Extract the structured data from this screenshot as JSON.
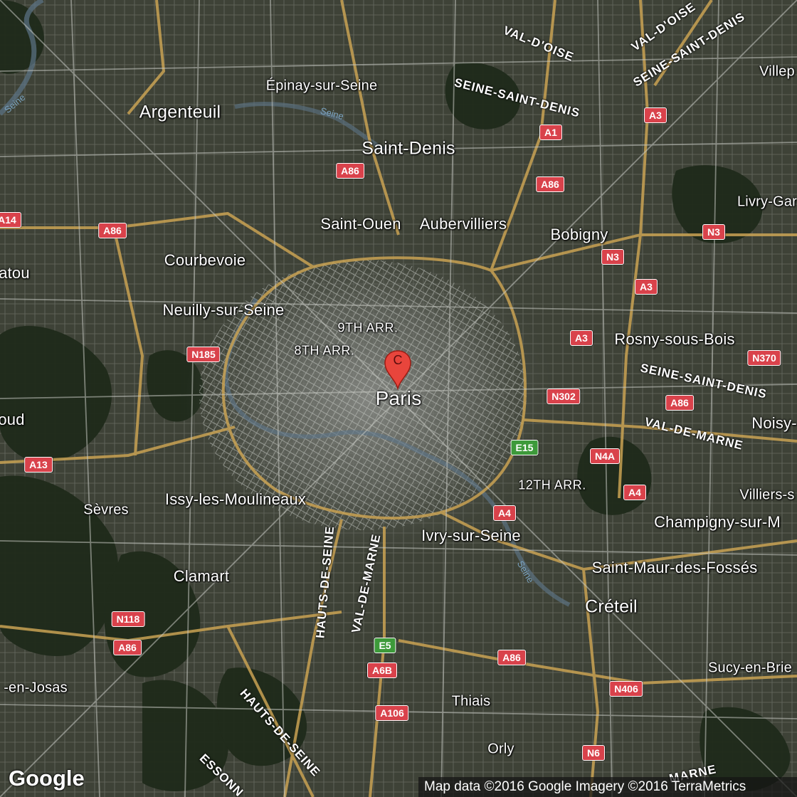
{
  "map": {
    "marker_letter": "C",
    "places": [
      {
        "id": "epinay",
        "label": "Épinay-sur-Seine",
        "size": "small"
      },
      {
        "id": "argenteuil",
        "label": "Argenteuil",
        "size": "large"
      },
      {
        "id": "saint-denis",
        "label": "Saint-Denis",
        "size": "large"
      },
      {
        "id": "villepinte",
        "label": "Villep",
        "size": "small"
      },
      {
        "id": "livry",
        "label": "Livry-Gar",
        "size": "small"
      },
      {
        "id": "saint-ouen",
        "label": "Saint-Ouen",
        "size": "mid"
      },
      {
        "id": "aubervilliers",
        "label": "Aubervilliers",
        "size": "mid"
      },
      {
        "id": "bobigny",
        "label": "Bobigny",
        "size": "mid"
      },
      {
        "id": "courbevoie",
        "label": "Courbevoie",
        "size": "mid"
      },
      {
        "id": "chatou",
        "label": "atou",
        "size": "mid"
      },
      {
        "id": "neuilly",
        "label": "Neuilly-sur-Seine",
        "size": "mid"
      },
      {
        "id": "9th",
        "label": "9TH ARR.",
        "size": "arr"
      },
      {
        "id": "8th",
        "label": "8TH ARR.",
        "size": "arr"
      },
      {
        "id": "rosny",
        "label": "Rosny-sous-Bois",
        "size": "mid"
      },
      {
        "id": "paris",
        "label": "Paris",
        "size": "major"
      },
      {
        "id": "saint-cloud",
        "label": "oud",
        "size": "mid"
      },
      {
        "id": "noisy",
        "label": "Noisy-",
        "size": "mid"
      },
      {
        "id": "12th",
        "label": "12TH ARR.",
        "size": "arr"
      },
      {
        "id": "villiers",
        "label": "Villiers-s",
        "size": "small"
      },
      {
        "id": "sevres",
        "label": "Sèvres",
        "size": "small"
      },
      {
        "id": "issy",
        "label": "Issy-les-Moulineaux",
        "size": "mid"
      },
      {
        "id": "champigny",
        "label": "Champigny-sur-M",
        "size": "mid"
      },
      {
        "id": "ivry",
        "label": "Ivry-sur-Seine",
        "size": "mid"
      },
      {
        "id": "clamart",
        "label": "Clamart",
        "size": "mid"
      },
      {
        "id": "saint-maur",
        "label": "Saint-Maur-des-Fossés",
        "size": "mid"
      },
      {
        "id": "creteil",
        "label": "Créteil",
        "size": "large"
      },
      {
        "id": "sucy",
        "label": "Sucy-en-Brie",
        "size": "small"
      },
      {
        "id": "jouy",
        "label": "-en-Josas",
        "size": "small"
      },
      {
        "id": "thiais",
        "label": "Thiais",
        "size": "small"
      },
      {
        "id": "orly",
        "label": "Orly",
        "size": "small"
      }
    ],
    "departments": [
      {
        "id": "val-doise-1",
        "label": "VAL-D'OISE"
      },
      {
        "id": "val-doise-2",
        "label": "VAL-D'OISE"
      },
      {
        "id": "ssd-1",
        "label": "SEINE-SAINT-DENIS"
      },
      {
        "id": "ssd-2",
        "label": "SEINE-SAINT-DENIS"
      },
      {
        "id": "ssd-3",
        "label": "SEINE-SAINT-DENIS"
      },
      {
        "id": "vdm-1",
        "label": "VAL-DE-MARNE"
      },
      {
        "id": "vdm-2",
        "label": "VAL-DE-MARNE"
      },
      {
        "id": "vdm-3",
        "label": "MARNE"
      },
      {
        "id": "hds-1",
        "label": "HAUTS-DE-SEINE"
      },
      {
        "id": "hds-2",
        "label": "HAUTS-DE-SEINE"
      },
      {
        "id": "essonne",
        "label": "ESSONN"
      }
    ],
    "roads": [
      {
        "id": "a3-top",
        "label": "A3",
        "kind": "red"
      },
      {
        "id": "a1",
        "label": "A1",
        "kind": "red"
      },
      {
        "id": "a86-top",
        "label": "A86",
        "kind": "red"
      },
      {
        "id": "a86-ne",
        "label": "A86",
        "kind": "red"
      },
      {
        "id": "a14",
        "label": "A14",
        "kind": "red"
      },
      {
        "id": "a86-w",
        "label": "A86",
        "kind": "red"
      },
      {
        "id": "n3-e",
        "label": "N3",
        "kind": "red"
      },
      {
        "id": "n3-mid",
        "label": "N3",
        "kind": "red"
      },
      {
        "id": "a3-mid",
        "label": "A3",
        "kind": "red"
      },
      {
        "id": "a3-low",
        "label": "A3",
        "kind": "red"
      },
      {
        "id": "n370",
        "label": "N370",
        "kind": "red"
      },
      {
        "id": "n185",
        "label": "N185",
        "kind": "red"
      },
      {
        "id": "n302",
        "label": "N302",
        "kind": "red"
      },
      {
        "id": "a86-e",
        "label": "A86",
        "kind": "red"
      },
      {
        "id": "e15",
        "label": "E15",
        "kind": "euro"
      },
      {
        "id": "n4a",
        "label": "N4A",
        "kind": "red"
      },
      {
        "id": "a13",
        "label": "A13",
        "kind": "red"
      },
      {
        "id": "a4-e",
        "label": "A4",
        "kind": "red"
      },
      {
        "id": "a4-mid",
        "label": "A4",
        "kind": "red"
      },
      {
        "id": "n118",
        "label": "N118",
        "kind": "red"
      },
      {
        "id": "a86-sw",
        "label": "A86",
        "kind": "red"
      },
      {
        "id": "e5",
        "label": "E5",
        "kind": "euro"
      },
      {
        "id": "a86-se",
        "label": "A86",
        "kind": "red"
      },
      {
        "id": "a6b",
        "label": "A6B",
        "kind": "red"
      },
      {
        "id": "n406",
        "label": "N406",
        "kind": "red"
      },
      {
        "id": "a106",
        "label": "A106",
        "kind": "red"
      },
      {
        "id": "n6",
        "label": "N6",
        "kind": "red"
      }
    ],
    "rivers": [
      {
        "id": "seine-nw",
        "label": "Seine"
      },
      {
        "id": "seine-n",
        "label": "Seine"
      },
      {
        "id": "seine-se",
        "label": "Seine"
      }
    ]
  },
  "branding": {
    "logo": "Google"
  },
  "attribution": "Map data ©2016 Google   Imagery ©2016 TerraMetrics",
  "colors": {
    "road_shield": "#d9424b",
    "euro_shield": "#3d9a3a",
    "marker": "#e8453c"
  }
}
